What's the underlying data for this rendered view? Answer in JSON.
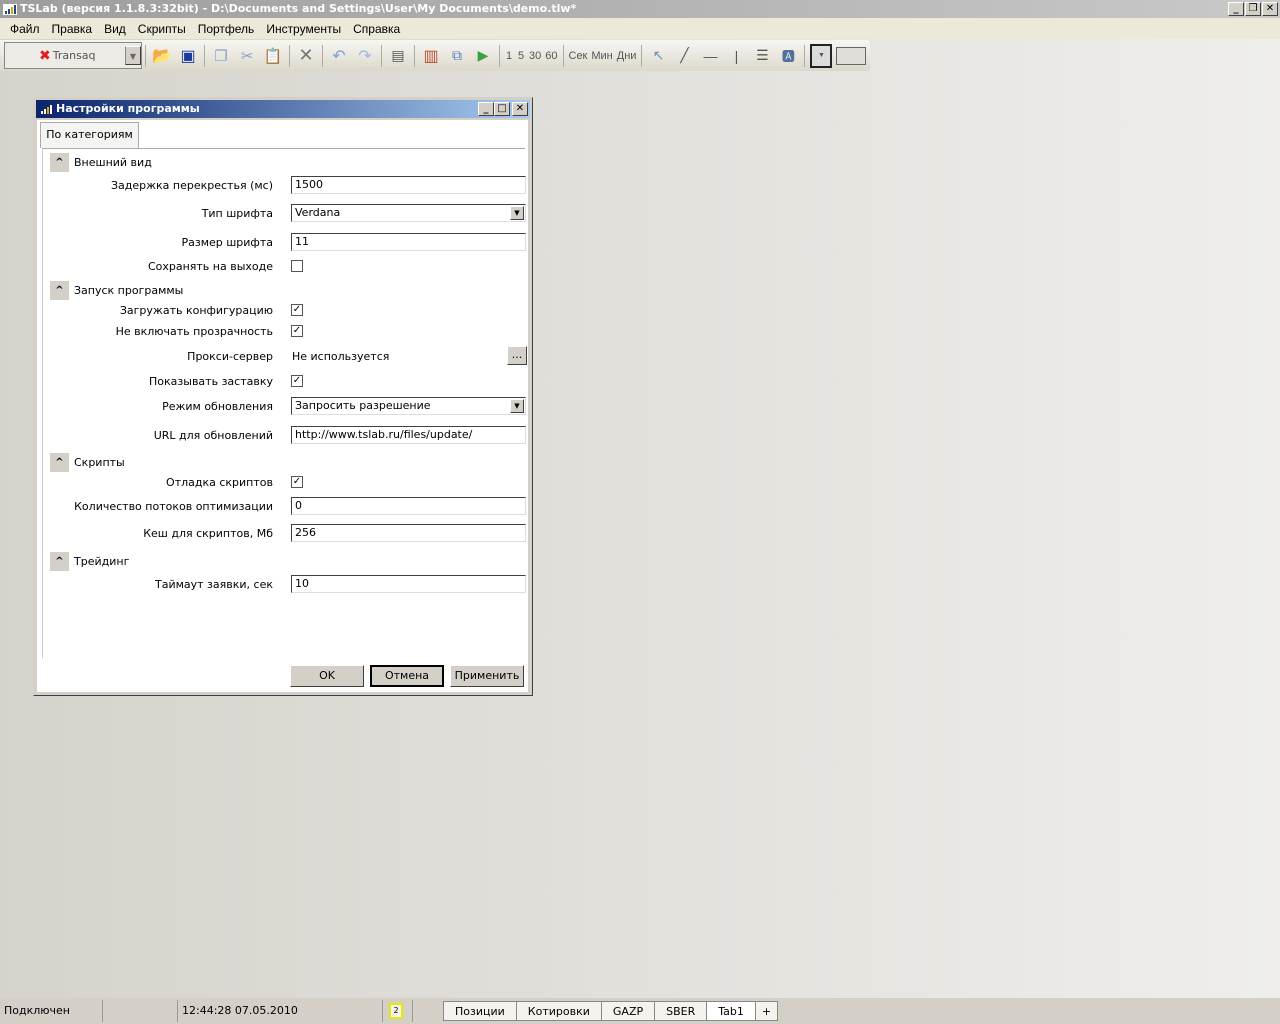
{
  "app": {
    "title": "TSLab (версия 1.1.8.3:32bit) - D:\\Documents and Settings\\User\\My Documents\\demo.tlw*"
  },
  "menu": [
    "Файл",
    "Правка",
    "Вид",
    "Скрипты",
    "Портфель",
    "Инструменты",
    "Справка"
  ],
  "toolbar": {
    "connector": "Transaq",
    "intervals": [
      "1",
      "5",
      "30",
      "60"
    ],
    "units": [
      "Сек",
      "Мин",
      "Дни"
    ]
  },
  "dialog": {
    "title": "Настройки программы",
    "tab": "По категориям",
    "sections": {
      "appearance": "Внешний вид",
      "startup": "Запуск программы",
      "scripts": "Скрипты",
      "trading": "Трейдинг"
    },
    "fields": {
      "crosshair_delay": {
        "label": "Задержка перекрестья (мс)",
        "value": "1500"
      },
      "font_type": {
        "label": "Тип шрифта",
        "value": "Verdana"
      },
      "font_size": {
        "label": "Размер шрифта",
        "value": "11"
      },
      "save_on_exit": {
        "label": "Сохранять на выходе",
        "checked": false
      },
      "load_config": {
        "label": "Загружать конфигурацию",
        "checked": true
      },
      "no_transparency": {
        "label": "Не включать прозрачность",
        "checked": true
      },
      "proxy": {
        "label": "Прокси-сервер",
        "value": "Не используется",
        "button": "..."
      },
      "splash": {
        "label": "Показывать заставку",
        "checked": true
      },
      "update_mode": {
        "label": "Режим обновления",
        "value": "Запросить разрешение"
      },
      "update_url": {
        "label": "URL для обновлений",
        "value": "http://www.tslab.ru/files/update/"
      },
      "debug_scripts": {
        "label": "Отладка скриптов",
        "checked": true
      },
      "opt_threads": {
        "label": "Количество потоков оптимизации",
        "value": "0"
      },
      "script_cache": {
        "label": "Кеш для скриптов, Мб",
        "value": "256"
      },
      "order_timeout": {
        "label": "Таймаут заявки, сек",
        "value": "10"
      }
    },
    "buttons": {
      "ok": "OK",
      "cancel": "Отмена",
      "apply": "Применить"
    }
  },
  "status": {
    "connection": "Подключен",
    "datetime": "12:44:28 07.05.2010",
    "badge": "2",
    "tabs": [
      "Позиции",
      "Котировки",
      "GAZP",
      "SBER",
      "Tab1",
      "+"
    ]
  }
}
